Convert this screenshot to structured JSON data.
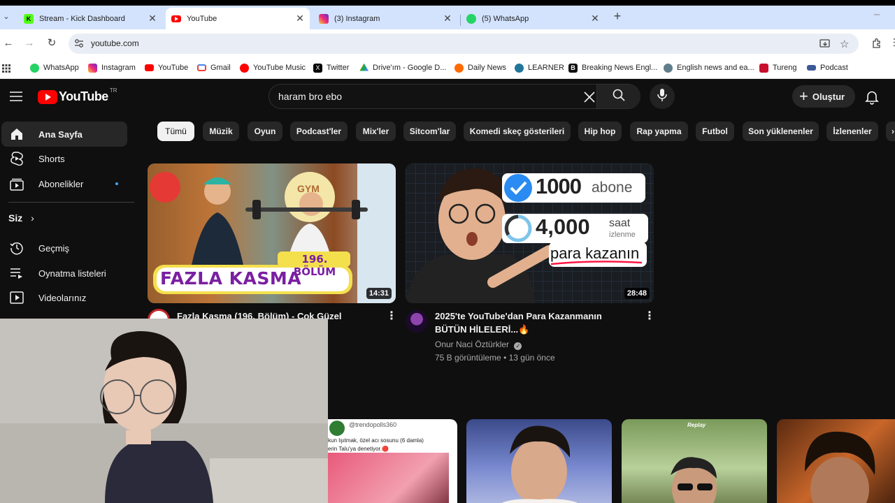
{
  "browser": {
    "tabs": [
      {
        "title": "Stream - Kick Dashboard",
        "color": "#53fc18"
      },
      {
        "title": "YouTube",
        "color": "#ff0000"
      },
      {
        "title": "(3) Instagram",
        "color": "#e1306c"
      },
      {
        "title": "(5) WhatsApp",
        "color": "#25d366"
      }
    ],
    "new_tab_label": "+",
    "url": "youtube.com",
    "bookmarks": [
      {
        "label": "WhatsApp",
        "color": "#25d366"
      },
      {
        "label": "Instagram",
        "color": "#e1306c"
      },
      {
        "label": "YouTube",
        "color": "#ff0000"
      },
      {
        "label": "Gmail",
        "color": "#ea4335"
      },
      {
        "label": "YouTube Music",
        "color": "#ff0000"
      },
      {
        "label": "Twitter",
        "color": "#000000"
      },
      {
        "label": "Drive'ım - Google D...",
        "color": "#1fa463"
      },
      {
        "label": "Daily News",
        "color": "#ff6a00"
      },
      {
        "label": "LEARNER",
        "color": "#21759b"
      },
      {
        "label": "Breaking News Engl...",
        "color": "#111111"
      },
      {
        "label": "English news and ea...",
        "color": "#607d8b"
      },
      {
        "label": "Tureng",
        "color": "#c8102e"
      },
      {
        "label": "Podcast",
        "color": "#3b5998"
      }
    ]
  },
  "youtube": {
    "logo_text": "YouTube",
    "country_code": "TR",
    "search_value": "haram bro ebo",
    "create_label": "Oluştur",
    "sidebar": {
      "items": [
        {
          "label": "Ana Sayfa",
          "icon": "home-icon"
        },
        {
          "label": "Shorts",
          "icon": "shorts-icon"
        },
        {
          "label": "Abonelikler",
          "icon": "subscriptions-icon"
        }
      ],
      "you_label": "Siz",
      "you_items": [
        {
          "label": "Geçmiş",
          "icon": "history-icon"
        },
        {
          "label": "Oynatma listeleri",
          "icon": "playlists-icon"
        },
        {
          "label": "Videolarınız",
          "icon": "your-videos-icon"
        }
      ]
    },
    "chips": [
      "Tümü",
      "Müzik",
      "Oyun",
      "Podcast'ler",
      "Mix'ler",
      "Sitcom'lar",
      "Komedi skeç gösterileri",
      "Hip hop",
      "Rap yapma",
      "Futbol",
      "Son yüklenenler",
      "İzlenenler"
    ],
    "videos": [
      {
        "title": "Fazla Kasma (196. Bölüm) - Çok Güzel",
        "duration": "14:31",
        "thumb_text_main": "FAZLA KASMA",
        "thumb_text_episode": "196. BÖLÜM",
        "thumb_text_gym": "GYM"
      },
      {
        "title_line1": "2025'te YouTube'dan Para Kazanmanın",
        "title_line2": "BÜTÜN HİLELERİ...🔥",
        "channel": "Onur Naci Öztürkler",
        "stats": "75 B görüntüleme • 13 gün önce",
        "duration": "28:48",
        "thumb_subs": "1000",
        "thumb_subs_label": "abone",
        "thumb_hours": "4,000",
        "thumb_hours_label1": "saat",
        "thumb_hours_label2": "izlenme",
        "thumb_money": "para kazanın"
      }
    ],
    "shorts": [
      {
        "channel": "@trendopolls360",
        "caption_line1": "kun Işıtmak, özel acı sosunu (6 damla)",
        "caption_line2": "erin Talu'ya denetiyor.🔴"
      },
      {},
      {
        "badge": "Replay"
      },
      {}
    ]
  }
}
